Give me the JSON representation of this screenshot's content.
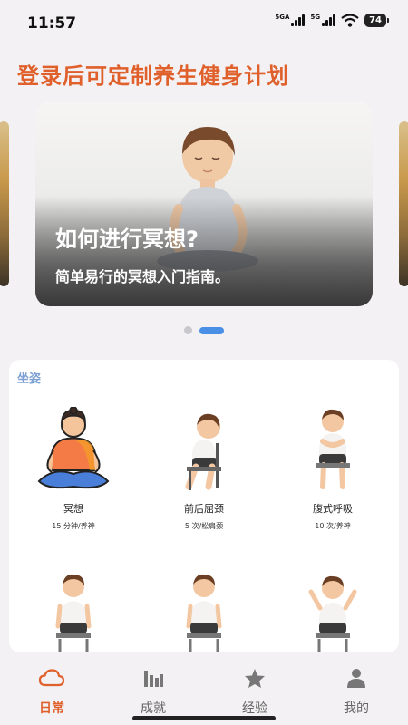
{
  "status": {
    "time": "11:57",
    "net1": "5GA",
    "net2": "5G",
    "battery": "74"
  },
  "header": {
    "title": "登录后可定制养生健身计划"
  },
  "carousel": {
    "title": "如何进行冥想?",
    "subtitle": "简单易行的冥想入门指南。",
    "active_index": 1
  },
  "section": {
    "title": "坐姿"
  },
  "exercises": [
    {
      "name": "冥想",
      "meta": "15 分钟/养神"
    },
    {
      "name": "前后屈颈",
      "meta": "5 次/松肩颈"
    },
    {
      "name": "腹式呼吸",
      "meta": "10 次/养神"
    },
    {
      "name": "",
      "meta": ""
    },
    {
      "name": "",
      "meta": ""
    },
    {
      "name": "",
      "meta": ""
    }
  ],
  "tabs": [
    {
      "label": "日常",
      "icon": "cloud-icon",
      "active": true
    },
    {
      "label": "成就",
      "icon": "bar-chart-icon",
      "active": false
    },
    {
      "label": "经验",
      "icon": "star-icon",
      "active": false
    },
    {
      "label": "我的",
      "icon": "person-icon",
      "active": false
    }
  ],
  "colors": {
    "accent": "#e0602c",
    "active_dot": "#4a8fe6",
    "section_title": "#7b9fd3"
  }
}
